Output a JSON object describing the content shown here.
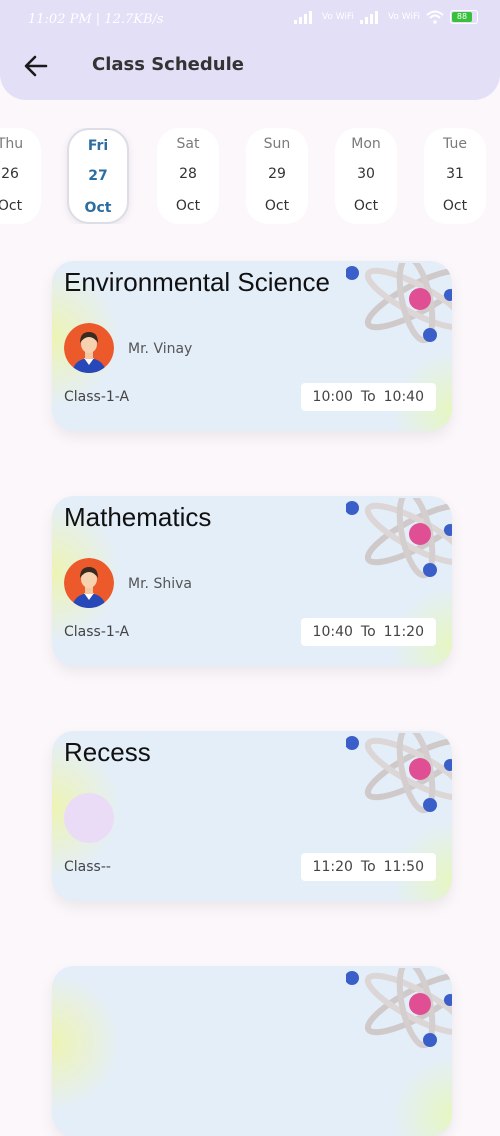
{
  "status_bar": {
    "time": "11:02 PM | 12.7KB/s",
    "vowifi_label": "Vo WiFi",
    "battery": "88"
  },
  "header": {
    "title": "Class Schedule"
  },
  "days": [
    {
      "weekday": "Thu",
      "day": "26",
      "month": "Oct",
      "selected": false
    },
    {
      "weekday": "Fri",
      "day": "27",
      "month": "Oct",
      "selected": true
    },
    {
      "weekday": "Sat",
      "day": "28",
      "month": "Oct",
      "selected": false
    },
    {
      "weekday": "Sun",
      "day": "29",
      "month": "Oct",
      "selected": false
    },
    {
      "weekday": "Mon",
      "day": "30",
      "month": "Oct",
      "selected": false
    },
    {
      "weekday": "Tue",
      "day": "31",
      "month": "Oct",
      "selected": false
    }
  ],
  "classes": [
    {
      "subject": "Environmental Science",
      "teacher": "Mr. Vinay",
      "class_name": "Class-1-A",
      "start": "10:00",
      "to": "To",
      "end": "10:40"
    },
    {
      "subject": "Mathematics",
      "teacher": "Mr. Shiva",
      "class_name": "Class-1-A",
      "start": "10:40",
      "to": "To",
      "end": "11:20"
    },
    {
      "subject": "Recess",
      "teacher": "",
      "class_name": "Class--",
      "start": "11:20",
      "to": "To",
      "end": "11:50"
    }
  ],
  "icons": {
    "back": "arrow-left-icon",
    "avatar": "teacher-avatar-icon",
    "decoration": "atom-icon"
  },
  "colors": {
    "appbar": "#e2dff7",
    "selected_day": "#2b6ea1",
    "card": "#e4eef9"
  }
}
